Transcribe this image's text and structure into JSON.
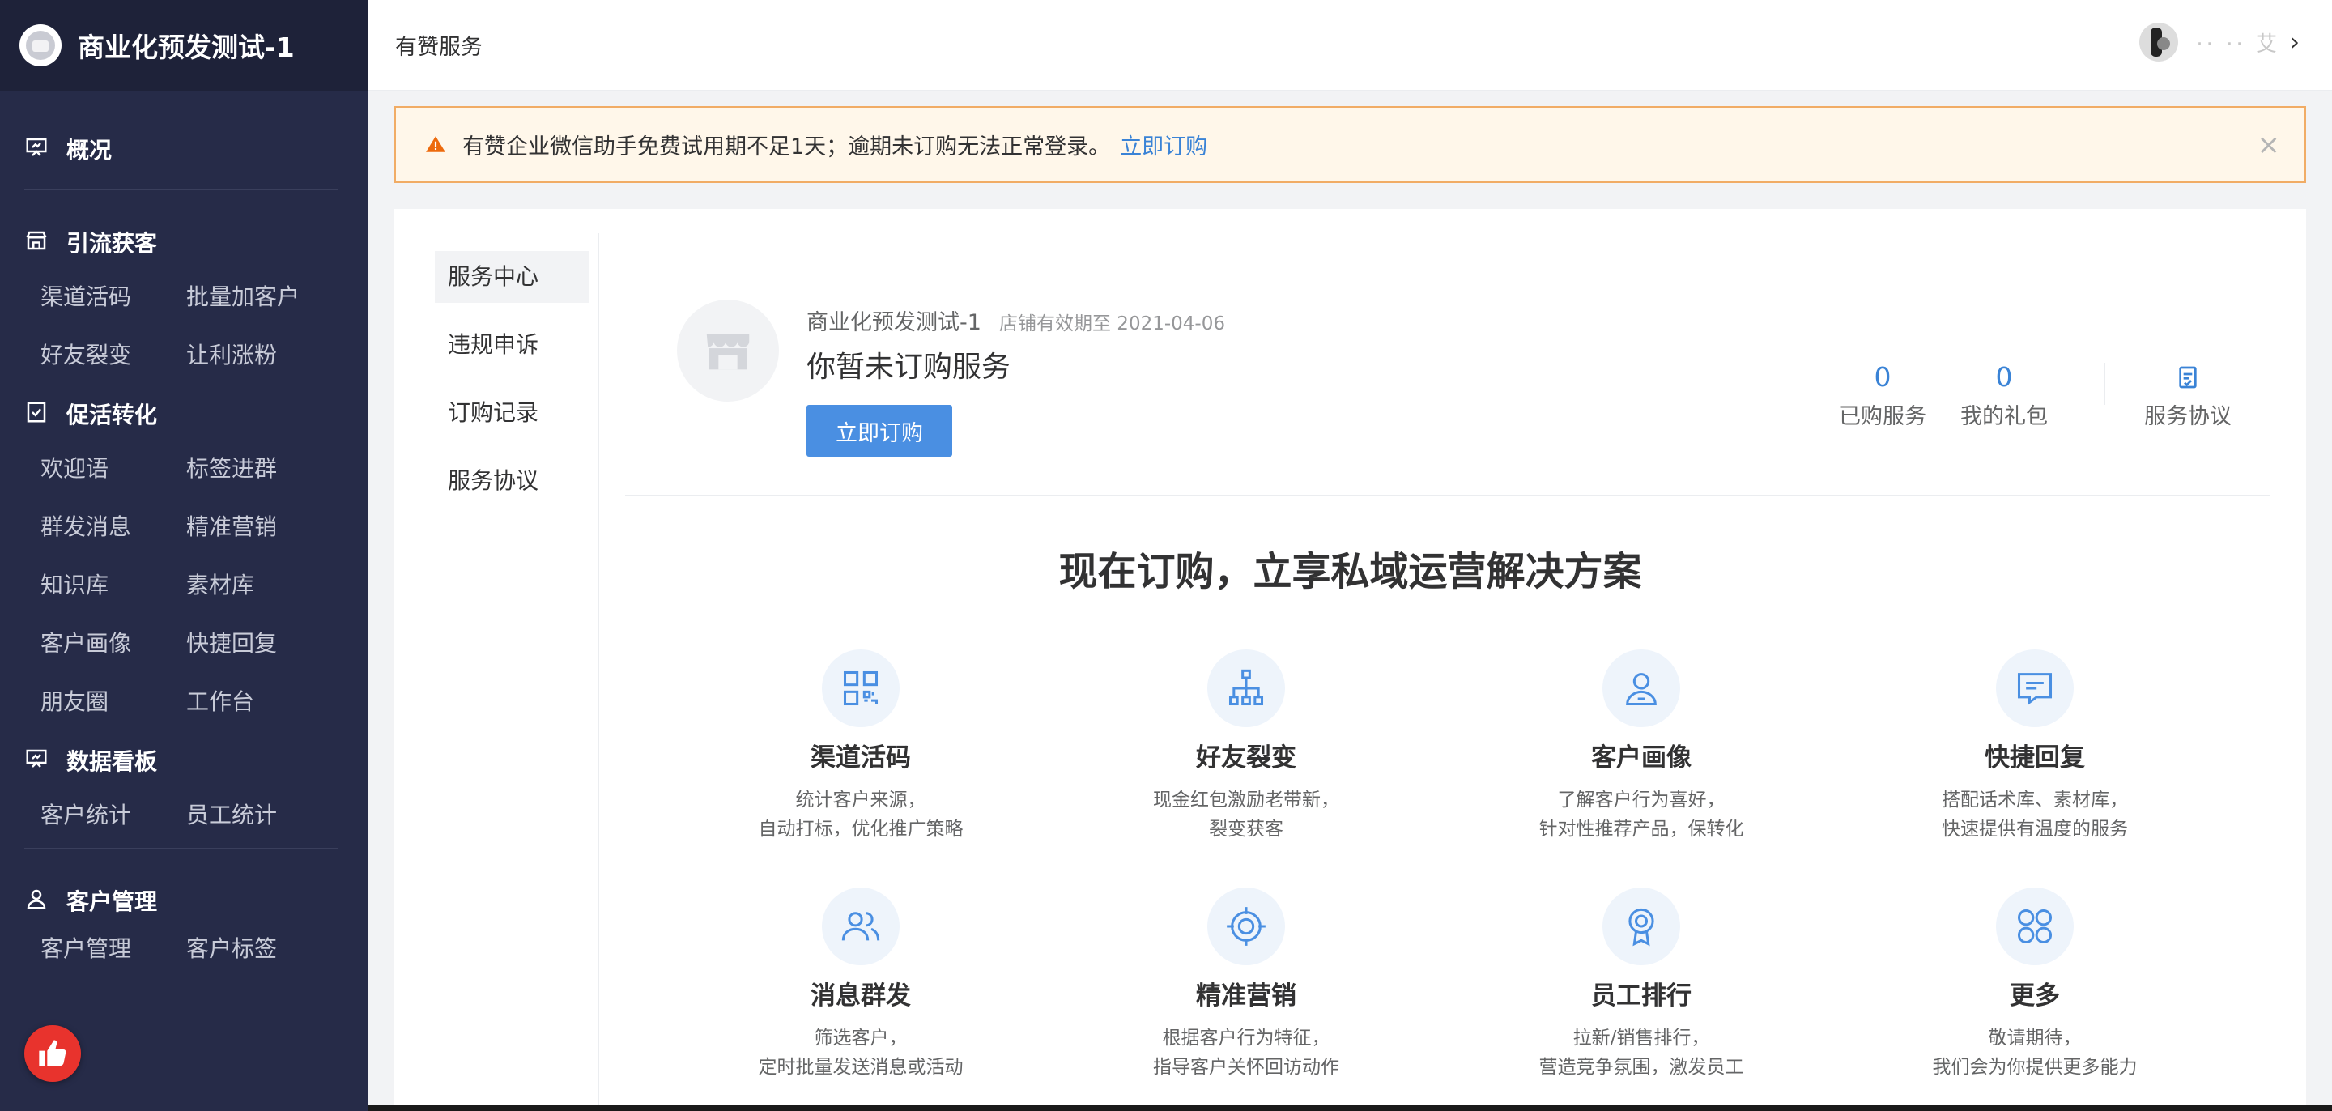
{
  "sidebar": {
    "brand": "商业化预发测试-1",
    "sections": [
      {
        "title": "概况",
        "icon": "presentation-icon",
        "items": []
      },
      {
        "title": "引流获客",
        "icon": "store-icon",
        "items": [
          "渠道活码",
          "批量加客户",
          "好友裂变",
          "让利涨粉"
        ]
      },
      {
        "title": "促活转化",
        "icon": "checklist-icon",
        "items": [
          "欢迎语",
          "标签进群",
          "群发消息",
          "精准营销",
          "知识库",
          "素材库",
          "客户画像",
          "快捷回复",
          "朋友圈",
          "工作台"
        ]
      },
      {
        "title": "数据看板",
        "icon": "dashboard-icon",
        "items": [
          "客户统计",
          "员工统计"
        ]
      },
      {
        "title": "客户管理",
        "icon": "user-icon",
        "items": [
          "客户管理",
          "客户标签"
        ]
      }
    ]
  },
  "topbar": {
    "title": "有赞服务",
    "user_name": "·· ·· 艾",
    "chevron": "›"
  },
  "alert": {
    "text": "有赞企业微信助手免费试用期不足1天；逾期未订购无法正常登录。",
    "link": "立即订购",
    "close": "×"
  },
  "subnav": [
    "服务中心",
    "违规申诉",
    "订购记录",
    "服务协议"
  ],
  "shop": {
    "name": "商业化预发测试-1",
    "expire": "店铺有效期至 2021-04-06",
    "status": "你暂未订购服务",
    "buy_button": "立即订购"
  },
  "stats": [
    {
      "value": "0",
      "label": "已购服务"
    },
    {
      "value": "0",
      "label": "我的礼包"
    }
  ],
  "agreement_label": "服务协议",
  "headline": "现在订购，立享私域运营解决方案",
  "features": [
    {
      "icon": "qrcode-icon",
      "title": "渠道活码",
      "desc1": "统计客户来源，",
      "desc2": "自动打标，优化推广策略"
    },
    {
      "icon": "network-icon",
      "title": "好友裂变",
      "desc1": "现金红包激励老带新，",
      "desc2": "裂变获客"
    },
    {
      "icon": "profile-icon",
      "title": "客户画像",
      "desc1": "了解客户行为喜好，",
      "desc2": "针对性推荐产品，保转化"
    },
    {
      "icon": "message-icon",
      "title": "快捷回复",
      "desc1": "搭配话术库、素材库，",
      "desc2": "快速提供有温度的服务"
    },
    {
      "icon": "group-icon",
      "title": "消息群发",
      "desc1": "筛选客户，",
      "desc2": "定时批量发送消息或活动"
    },
    {
      "icon": "target-icon",
      "title": "精准营销",
      "desc1": "根据客户行为特征，",
      "desc2": "指导客户关怀回访动作"
    },
    {
      "icon": "medal-icon",
      "title": "员工排行",
      "desc1": "拉新/销售排行，",
      "desc2": "营造竞争氛围，激发员工"
    },
    {
      "icon": "more-icon",
      "title": "更多",
      "desc1": "敬请期待，",
      "desc2": "我们会为你提供更多能力"
    }
  ],
  "colors": {
    "sidebar_bg": "#262b48",
    "accent": "#3a83d6",
    "alert_border": "#f1ac65",
    "like": "#e8332d"
  }
}
